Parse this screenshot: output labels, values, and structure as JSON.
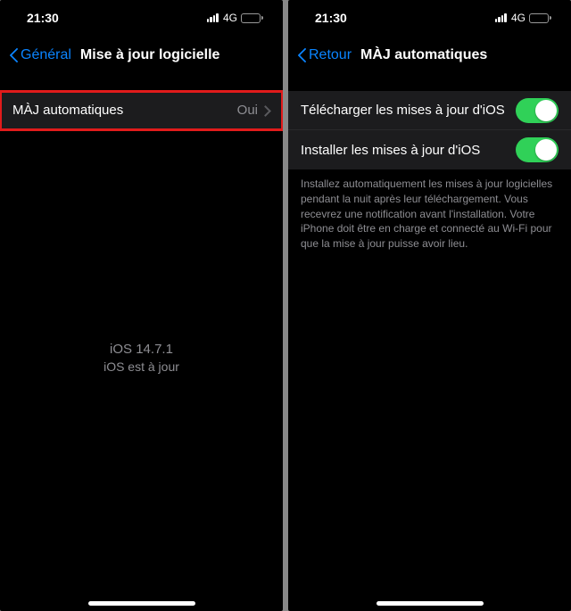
{
  "left": {
    "status": {
      "time": "21:30",
      "network": "4G"
    },
    "nav": {
      "back": "Général",
      "title": "Mise à jour logicielle"
    },
    "row": {
      "label": "MÀJ automatiques",
      "value": "Oui"
    },
    "info": {
      "version": "iOS 14.7.1",
      "status": "iOS est à jour"
    }
  },
  "right": {
    "status": {
      "time": "21:30",
      "network": "4G"
    },
    "nav": {
      "back": "Retour",
      "title": "MÀJ automatiques"
    },
    "rows": [
      {
        "label": "Télécharger les mises à jour d'iOS",
        "on": true
      },
      {
        "label": "Installer les mises à jour d'iOS",
        "on": true
      }
    ],
    "footer": "Installez automatiquement les mises à jour logicielles pendant la nuit après leur téléchargement. Vous recevrez une notification avant l'installation. Votre iPhone doit être en charge et connecté au Wi-Fi pour que la mise à jour puisse avoir lieu."
  }
}
